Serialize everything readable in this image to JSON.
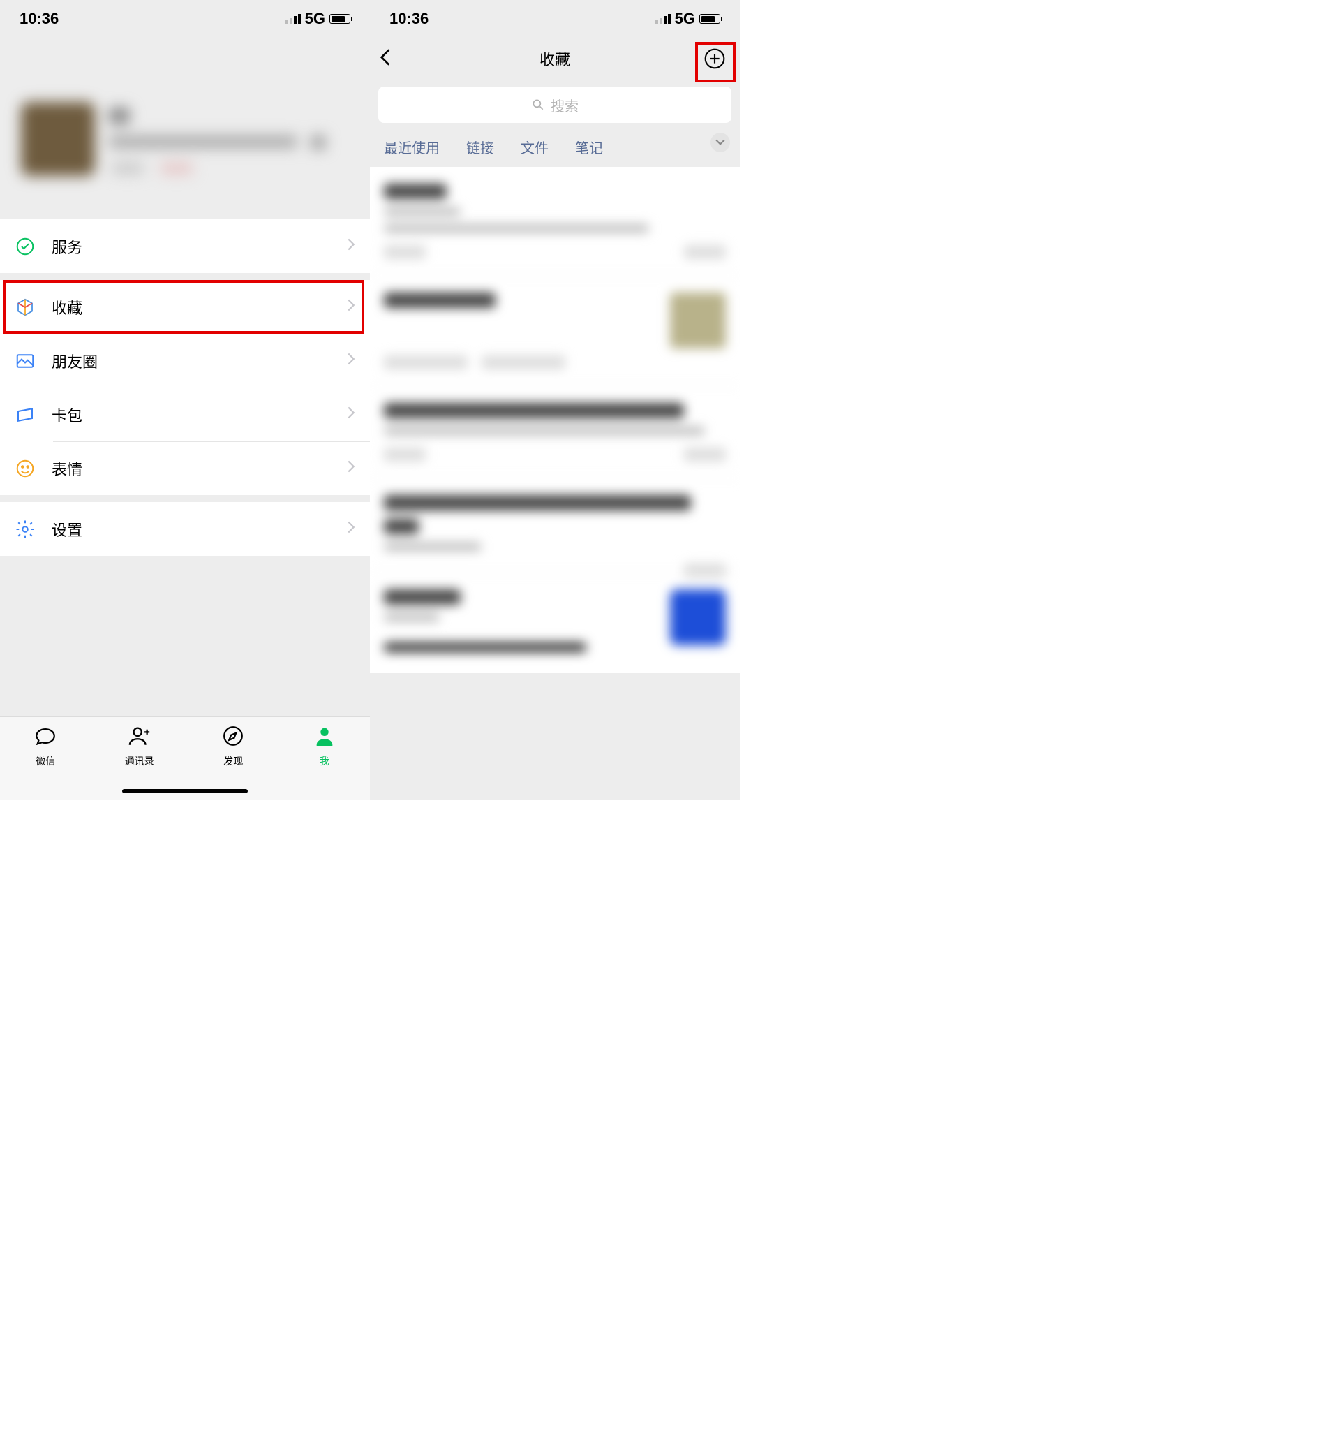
{
  "status": {
    "time": "10:36",
    "network": "5G"
  },
  "left": {
    "menu": {
      "services": "服务",
      "favorites": "收藏",
      "moments": "朋友圈",
      "cards": "卡包",
      "stickers": "表情",
      "settings": "设置"
    },
    "tabs": {
      "chats": "微信",
      "contacts": "通讯录",
      "discover": "发现",
      "me": "我"
    }
  },
  "right": {
    "title": "收藏",
    "search_placeholder": "搜索",
    "filters": {
      "recent": "最近使用",
      "links": "链接",
      "files": "文件",
      "notes": "笔记"
    }
  }
}
